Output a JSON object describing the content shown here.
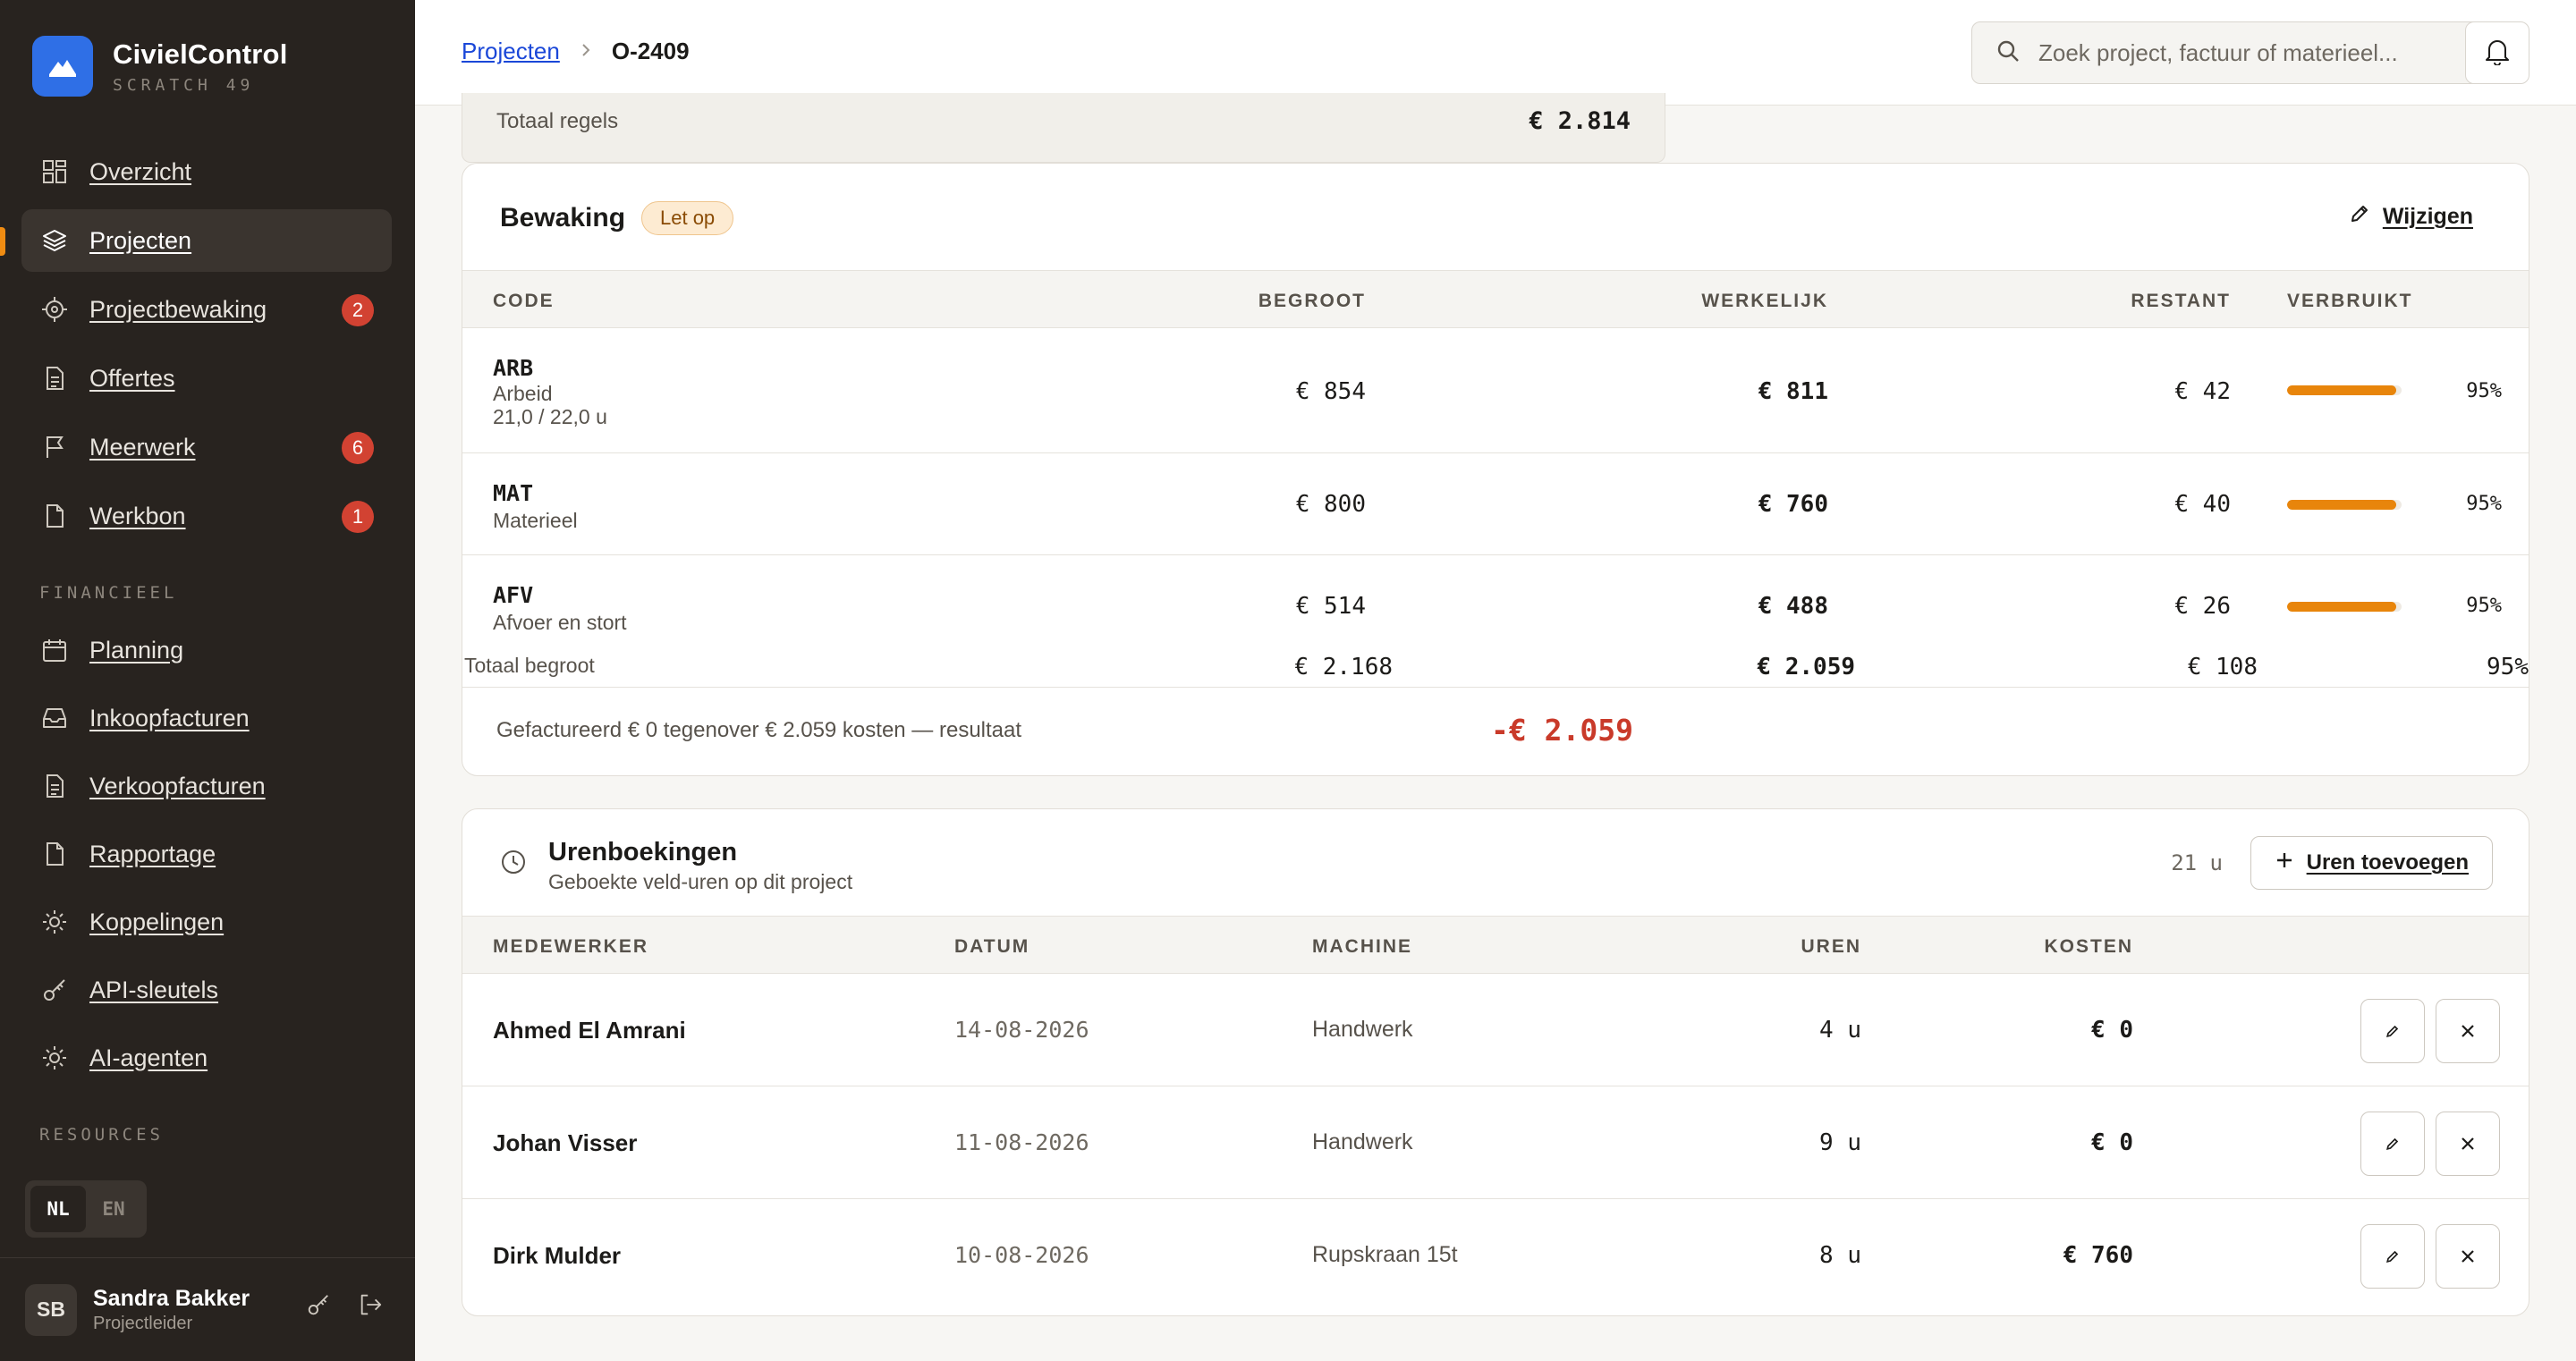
{
  "brand": {
    "title": "CivielControl",
    "subtitle": "SCRATCH 49"
  },
  "nav": [
    {
      "label": "Overzicht",
      "icon": "grid-icon"
    },
    {
      "label": "Projecten",
      "icon": "layers-icon",
      "active": true
    },
    {
      "label": "Projectbewaking",
      "icon": "target-icon",
      "badge": "2"
    },
    {
      "label": "Offertes",
      "icon": "document-icon"
    },
    {
      "label": "Meerwerk",
      "icon": "flag-icon",
      "badge": "6"
    },
    {
      "label": "Werkbon",
      "icon": "file-icon",
      "badge": "1"
    }
  ],
  "sections": {
    "financieel": "FINANCIEEL",
    "resources": "RESOURCES"
  },
  "nav_fin": [
    {
      "label": "Planning",
      "icon": "calendar-icon"
    },
    {
      "label": "Inkoopfacturen",
      "icon": "inbox-icon"
    },
    {
      "label": "Verkoopfacturen",
      "icon": "invoice-icon"
    },
    {
      "label": "Rapportage",
      "icon": "report-icon"
    },
    {
      "label": "Koppelingen",
      "icon": "sun-icon"
    },
    {
      "label": "API-sleutels",
      "icon": "key-icon"
    },
    {
      "label": "AI-agenten",
      "icon": "sparkle-icon"
    }
  ],
  "lang": {
    "nl": "NL",
    "en": "EN",
    "active": "NL"
  },
  "user": {
    "initials": "SB",
    "name": "Sandra Bakker",
    "role": "Projectleider"
  },
  "breadcrumb": {
    "parent": "Projecten",
    "current": "O-2409"
  },
  "search": {
    "placeholder": "Zoek project, factuur of materieel..."
  },
  "prev": {
    "label": "Totaal regels",
    "value": "€ 2.814"
  },
  "bewaking": {
    "title": "Bewaking",
    "status": "Let op",
    "edit_label": "Wijzigen",
    "columns": {
      "code": "CODE",
      "begroot": "BEGROOT",
      "werkelijk": "WERKELIJK",
      "restant": "RESTANT",
      "verbruikt": "VERBRUIKT"
    },
    "rows": [
      {
        "code": "ARB",
        "name": "Arbeid",
        "detail": "21,0 / 22,0 u",
        "begroot": "€ 854",
        "werkelijk": "€ 811",
        "restant": "€ 42",
        "pct": "95%",
        "fraction": 0.95
      },
      {
        "code": "MAT",
        "name": "Materieel",
        "detail": "",
        "begroot": "€ 800",
        "werkelijk": "€ 760",
        "restant": "€ 40",
        "pct": "95%",
        "fraction": 0.95
      },
      {
        "code": "AFV",
        "name": "Afvoer en stort",
        "detail": "",
        "begroot": "€ 514",
        "werkelijk": "€ 488",
        "restant": "€ 26",
        "pct": "95%",
        "fraction": 0.95
      }
    ],
    "total": {
      "label": "Totaal begroot",
      "begroot": "€ 2.168",
      "werkelijk": "€ 2.059",
      "restant": "€ 108",
      "pct": "95%"
    },
    "note": "Gefactureerd € 0 tegenover € 2.059 kosten — resultaat",
    "result": "-€ 2.059"
  },
  "uren": {
    "title": "Urenboekingen",
    "subtitle": "Geboekte veld-uren op dit project",
    "total": "21 u",
    "add_label": "Uren toevoegen",
    "columns": {
      "medewerker": "MEDEWERKER",
      "datum": "DATUM",
      "machine": "MACHINE",
      "uren": "UREN",
      "kosten": "KOSTEN"
    },
    "rows": [
      {
        "medewerker": "Ahmed El Amrani",
        "datum": "14-08-2026",
        "machine": "Handwerk",
        "uren": "4 u",
        "kosten": "€ 0"
      },
      {
        "medewerker": "Johan Visser",
        "datum": "11-08-2026",
        "machine": "Handwerk",
        "uren": "9 u",
        "kosten": "€ 0"
      },
      {
        "medewerker": "Dirk Mulder",
        "datum": "10-08-2026",
        "machine": "Rupskraan 15t",
        "uren": "8 u",
        "kosten": "€ 760"
      }
    ]
  },
  "colors": {
    "accent": "#f08c12",
    "brand": "#2f6fe6",
    "danger": "#c93a2a",
    "sidebar": "#28231f"
  }
}
